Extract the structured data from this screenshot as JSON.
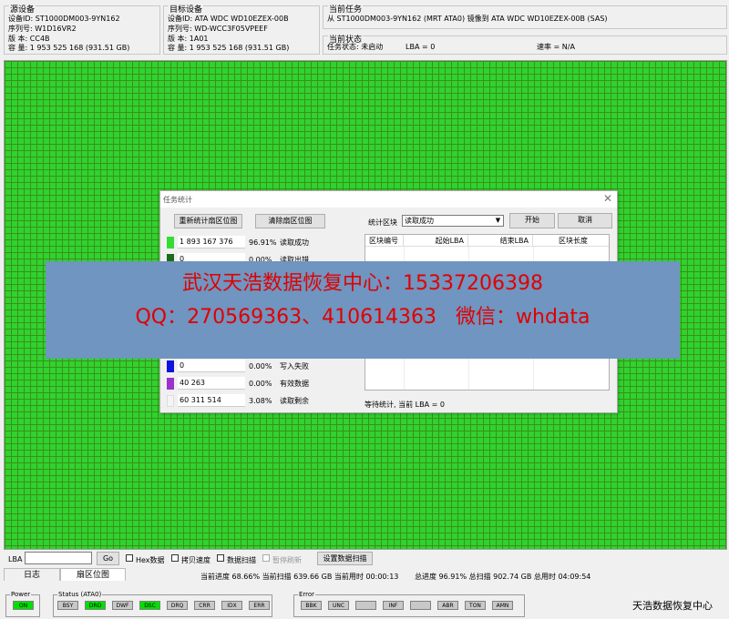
{
  "source": {
    "title": "源设备",
    "model": "设备ID: ST1000DM003-9YN162",
    "serial": "序列号: W1D16VR2",
    "firmware": "版   本: CC4B",
    "capacity": "容   量: 1 953 525 168 (931.51 GB)"
  },
  "target": {
    "title": "目标设备",
    "model": "设备ID: ATA WDC WD10EZEX-00B",
    "serial": "序列号: WD-WCC3F05VPEEF",
    "firmware": "版   本: 1A01",
    "capacity": "容   量: 1 953 525 168 (931.51 GB)"
  },
  "current_task": {
    "title": "当前任务",
    "description": "从 ST1000DM003-9YN162 (MRT ATA0) 镜像到 ATA WDC WD10EZEX-00B (SAS)"
  },
  "current_status": {
    "title": "当前状态",
    "task_state": "任务状态: 未启动",
    "lba": "LBA = 0",
    "speed": "速率 = N/A"
  },
  "dialog": {
    "title": "任务统计",
    "recount_button": "重新统计扇区位图",
    "clear_button": "清除扇区位图",
    "stat_block_label": "统计区块",
    "stat_block_selected": "读取成功",
    "start_button": "开始",
    "cancel_button": "取消",
    "stats": [
      {
        "value": "1 893 167 376",
        "pct": "96.91%",
        "label": "读取成功",
        "color": "#33dd33"
      },
      {
        "value": "0",
        "pct": "0.00%",
        "label": "读取出错",
        "color": "#1a6b1a"
      },
      {
        "value": "0",
        "pct": "0.00%",
        "label": "写入失败",
        "color": "#1111dd"
      },
      {
        "value": "40 263",
        "pct": "0.00%",
        "label": "有效数据",
        "color": "#9933cc"
      },
      {
        "value": "60 311 514",
        "pct": "3.08%",
        "label": "读取剩余",
        "color": "#f4f4f4"
      }
    ],
    "table_headers": [
      "区块编号",
      "起始LBA",
      "结束LBA",
      "区块长度"
    ],
    "footer": "等待统计, 当前 LBA = 0"
  },
  "watermark": {
    "line1": "武汉天浩数据恢复中心：15337206398",
    "line2": "QQ：270569363、410614363   微信：whdata"
  },
  "controls": {
    "lba_label": "LBA",
    "go_button": "Go",
    "hex_data": "Hex数据",
    "copy_speed": "拷贝速度",
    "data_scan": "数据扫描",
    "pause_refresh": "暂停刷新",
    "set_scan_button": "设置数据扫描"
  },
  "tabs": [
    "日志",
    "扇区位图"
  ],
  "progress": {
    "current_progress": "当前进度 68.66% 当前扫描 639.66 GB 当前用时 00:00:13",
    "total_progress": "总进度 96.91% 总扫描 902.74 GB 总用时 04:09:54"
  },
  "status_bar": {
    "power_label": "Power",
    "power_led": "ON",
    "status_label": "Status (ATA0)",
    "status_leds": [
      {
        "label": "BSY",
        "on": false
      },
      {
        "label": "DRD",
        "on": true
      },
      {
        "label": "DWF",
        "on": false
      },
      {
        "label": "DSC",
        "on": true
      },
      {
        "label": "DRQ",
        "on": false
      },
      {
        "label": "CRR",
        "on": false
      },
      {
        "label": "IDX",
        "on": false
      },
      {
        "label": "ERR",
        "on": false
      }
    ],
    "error_label": "Error",
    "error_leds": [
      {
        "label": "BBK"
      },
      {
        "label": "UNC"
      },
      {
        "label": ""
      },
      {
        "label": "INF"
      },
      {
        "label": ""
      },
      {
        "label": "ABR"
      },
      {
        "label": "TON"
      },
      {
        "label": "AMN"
      }
    ]
  },
  "footer_brand": "天浩数据恢复中心",
  "sector_map": {
    "filled_color": "#2fd32f",
    "line_color": "#3d8f1a"
  }
}
